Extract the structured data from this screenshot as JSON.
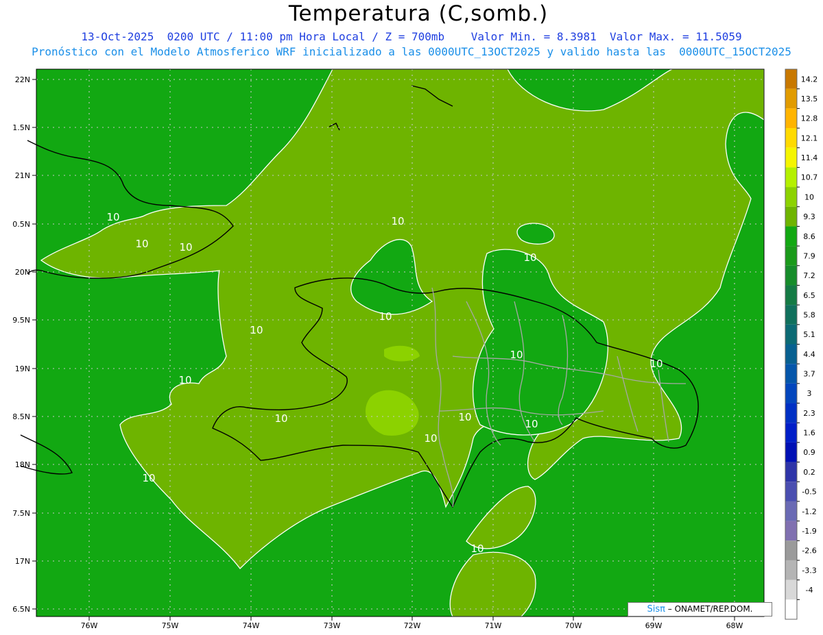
{
  "title": "Temperatura (C,somb.)",
  "subtitle_line1": "13-Oct-2025  0200 UTC / 11:00 pm Hora Local / Z = 700mb    Valor Min. = 8.3981  Valor Max. = 11.5059",
  "subtitle_line2": "Pronóstico con el Modelo Atmosferico WRF inicializado a las 0000UTC_13OCT2025 y valido hasta las  0000UTC_15OCT2025",
  "credit": {
    "logo": "Sisπ",
    "text": " – ONAMET/REP.DOM."
  },
  "lat_labels": [
    "22N",
    "1.5N",
    "21N",
    "0.5N",
    "20N",
    "9.5N",
    "19N",
    "8.5N",
    "18N",
    "7.5N",
    "17N",
    "6.5N"
  ],
  "lon_labels": [
    "76W",
    "75W",
    "74W",
    "73W",
    "72W",
    "71W",
    "70W",
    "69W",
    "68W"
  ],
  "colorbar": {
    "labels": [
      "14.2",
      "13.5",
      "12.8",
      "12.1",
      "11.4",
      "10.7",
      "10",
      "9.3",
      "8.6",
      "7.9",
      "7.2",
      "6.5",
      "5.8",
      "5.1",
      "4.4",
      "3.7",
      "3",
      "2.3",
      "1.6",
      "0.9",
      "0.2",
      "-0.5",
      "-1.2",
      "-1.9",
      "-2.6",
      "-3.3",
      "-4"
    ],
    "colors": [
      "#c87800",
      "#e19b00",
      "#ffb400",
      "#ffda00",
      "#f5f500",
      "#b4f000",
      "#8cd200",
      "#6eb400",
      "#12a812",
      "#1a9a1a",
      "#168c2a",
      "#147a44",
      "#10705c",
      "#0c6a74",
      "#086090",
      "#0556aa",
      "#0346bd",
      "#0030c4",
      "#001ec8",
      "#0010b4",
      "#2e34a8",
      "#4a4eb0",
      "#6a6ab4",
      "#8070b0",
      "#9a9a9a",
      "#b4b4b4",
      "#d8d8d8",
      "#ffffff"
    ]
  },
  "contour_labels": [
    "10",
    "10",
    "10",
    "10",
    "10",
    "10",
    "10",
    "10",
    "10",
    "10",
    "10",
    "10",
    "10",
    "10",
    "10",
    "10"
  ],
  "colors": {
    "base_green": "#12a812",
    "olive": "#6eb400",
    "light": "#8cd200"
  }
}
